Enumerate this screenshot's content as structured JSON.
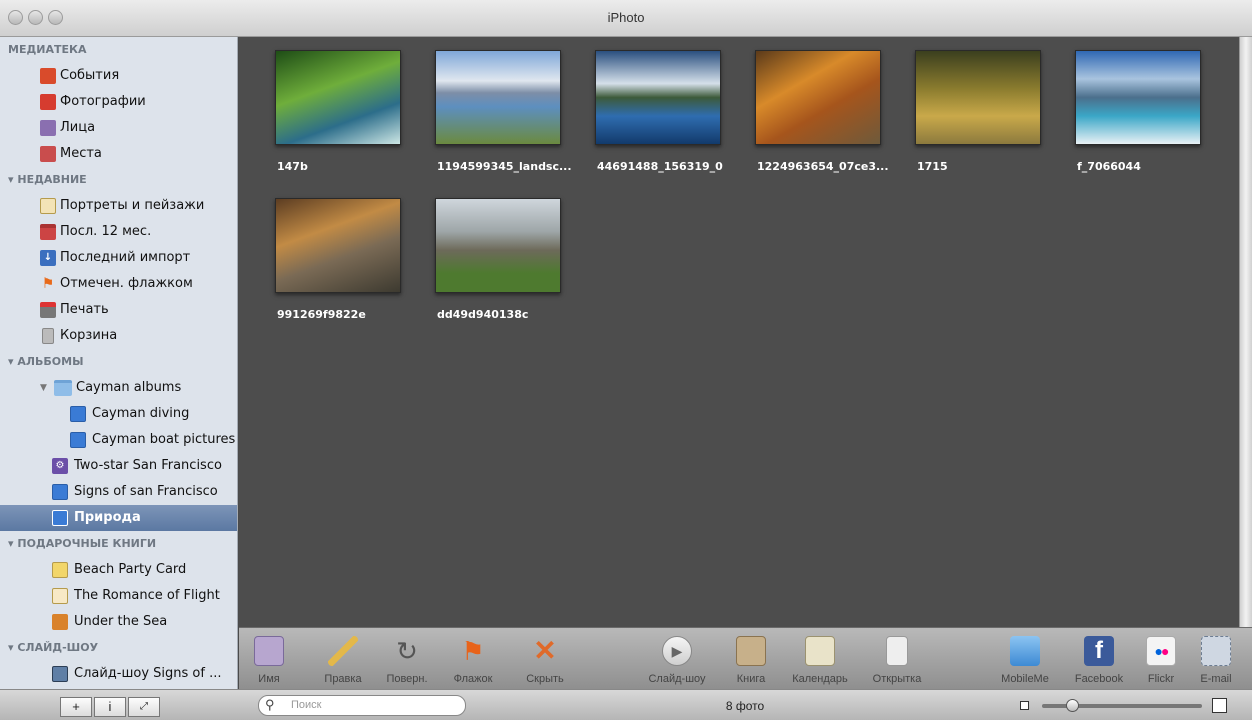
{
  "window": {
    "title": "iPhoto"
  },
  "sidebar": {
    "library_header": "МЕДИАТЕКА",
    "library": [
      "События",
      "Фотографии",
      "Лица",
      "Места"
    ],
    "recent_header": "НЕДАВНИЕ",
    "recent": [
      "Портреты и пейзажи",
      "Посл. 12 мес.",
      "Последний импорт",
      "Отмечен. флажком",
      "Печать",
      "Корзина"
    ],
    "albums_header": "АЛЬБОМЫ",
    "albums": [
      "Cayman albums",
      "Cayman diving",
      "Cayman boat pictures",
      "Two-star San Francisco",
      "Signs of san Francisco",
      "Природа"
    ],
    "books_header": "ПОДАРОЧНЫЕ КНИГИ",
    "books": [
      "Beach Party Card",
      "The Romance of Flight",
      "Under the Sea"
    ],
    "slideshows_header": "СЛАЙД-ШОУ",
    "slideshows": [
      "Слайд-шоу Signs of ..."
    ]
  },
  "photos": [
    "147b",
    "1194599345_landsc...",
    "44691488_156319_0",
    "1224963654_07ce3...",
    "1715",
    "f_7066044",
    "991269f9822e",
    "dd49d940138c"
  ],
  "toolbar": [
    "Имя",
    "Правка",
    "Поверн.",
    "Флажок",
    "Скрыть",
    "Слайд-шоу",
    "Книга",
    "Календарь",
    "Открытка",
    "MobileMe",
    "Facebook",
    "Flickr",
    "E-mail"
  ],
  "bottom": {
    "search_placeholder": "Поиск",
    "count": "8 фото"
  },
  "colors": {
    "selection": "#5b78a2",
    "content_bg": "#4d4d4d",
    "sidebar_bg": "#dde3eb"
  },
  "icons": [
    "add-icon",
    "info-icon",
    "fullscreen-icon",
    "search-icon",
    "zoom-small-icon",
    "zoom-large-icon"
  ]
}
